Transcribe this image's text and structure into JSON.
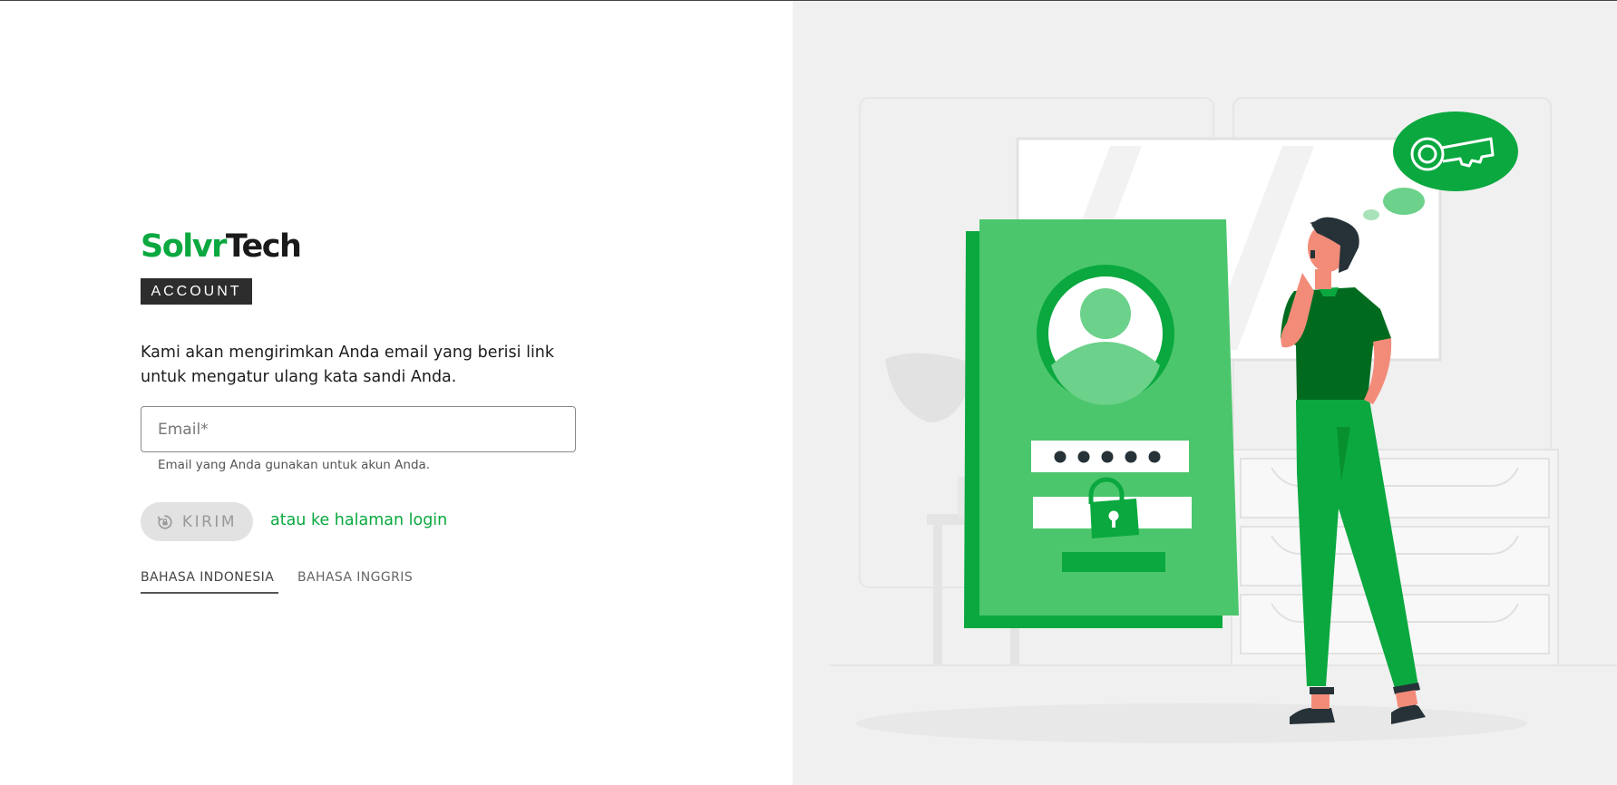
{
  "brand": {
    "name_part1": "Solvr",
    "name_part2": "Tech",
    "badge": "ACCOUNT",
    "green": "#0aa83f"
  },
  "form": {
    "description": "Kami akan mengirimkan Anda email yang berisi link untuk mengatur ulang kata sandi Anda.",
    "email_placeholder": "Email*",
    "email_value": "",
    "email_helper": "Email yang Anda gunakan untuk akun Anda.",
    "submit_label": "KIRIM",
    "submit_icon": "reset-lock-icon",
    "login_link": "atau ke halaman login"
  },
  "languages": {
    "indonesian": "BAHASA INDONESIA",
    "english": "BAHASA INGGRIS",
    "active": "indonesian"
  },
  "illustration": {
    "subject": "forgot-password-illustration",
    "dots": "●●●●●"
  }
}
